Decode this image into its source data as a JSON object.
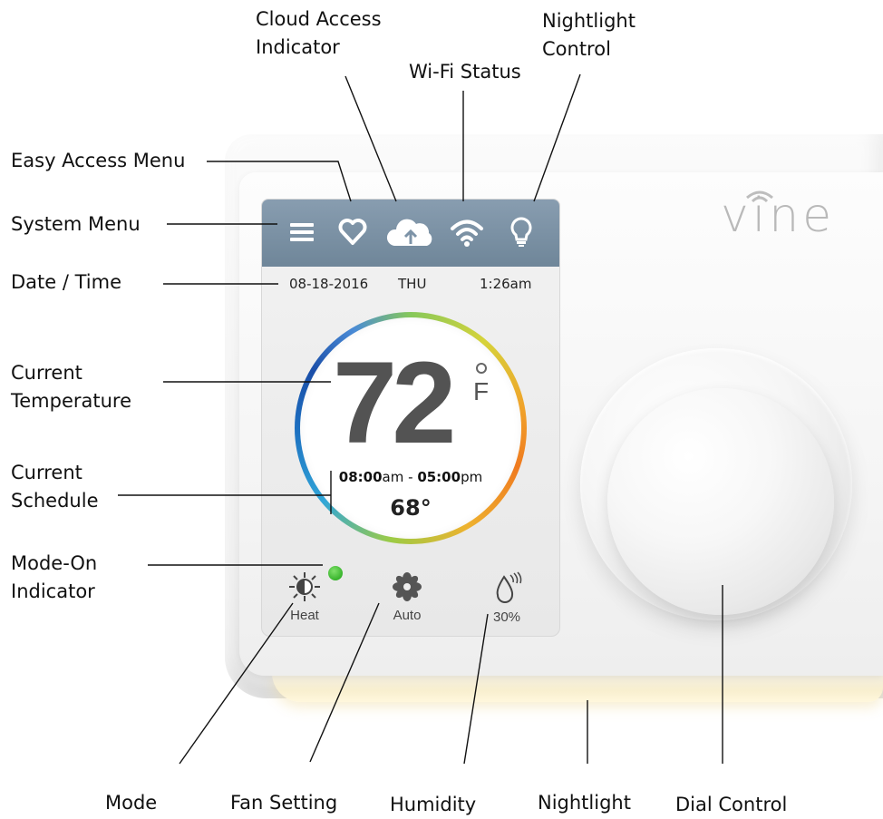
{
  "labels": {
    "cloud_access": [
      "Cloud Access",
      "Indicator"
    ],
    "nightlight_control": [
      "Nightlight",
      "Control"
    ],
    "wifi_status": "Wi-Fi Status",
    "easy_access_menu": "Easy Access Menu",
    "system_menu": "System Menu",
    "date_time": "Date / Time",
    "current_temperature": [
      "Current",
      "Temperature"
    ],
    "current_schedule": [
      "Current",
      "Schedule"
    ],
    "mode_on_indicator": [
      "Mode-On",
      "Indicator"
    ],
    "mode": "Mode",
    "fan_setting": "Fan Setting",
    "humidity": "Humidity",
    "nightlight": "Nightlight",
    "dial_control": "Dial Control"
  },
  "device": {
    "brand": "vine",
    "date": "08-18-2016",
    "day": "THU",
    "time": "1:26am",
    "temperature": "72",
    "unit": "F",
    "schedule_start": "08:00",
    "schedule_start_suffix": "am",
    "schedule_separator": " - ",
    "schedule_end": "05:00",
    "schedule_end_suffix": "pm",
    "set_temperature": "68°",
    "mode": "Heat",
    "fan": "Auto",
    "humidity": "30%"
  },
  "icons": [
    "hamburger-menu-icon",
    "heart-icon",
    "cloud-upload-icon",
    "wifi-icon",
    "lightbulb-icon",
    "sun-heat-icon",
    "fan-icon",
    "humidity-drop-icon"
  ]
}
